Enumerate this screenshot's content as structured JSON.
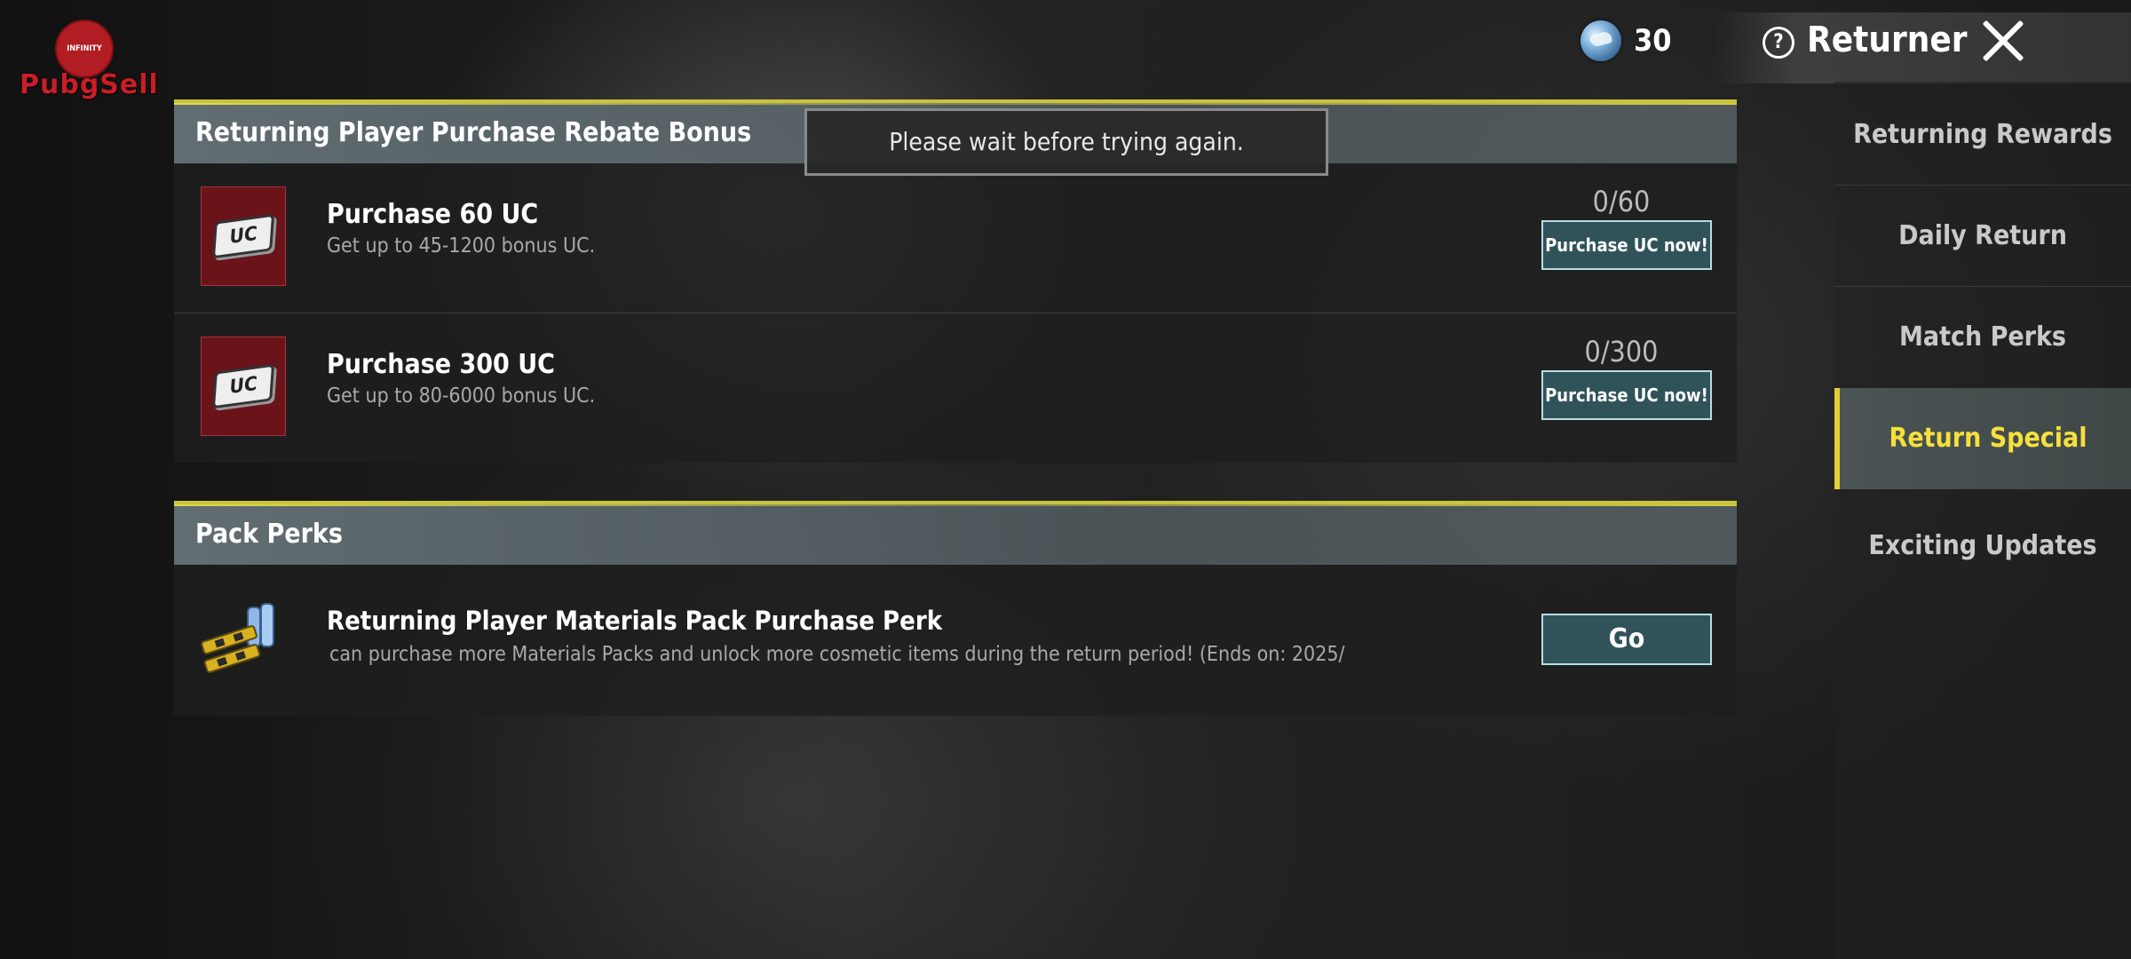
{
  "logo": {
    "badge_text": "INFINITY",
    "wordmark": "PubgSell"
  },
  "topbar": {
    "currency_value": "30",
    "title": "Returner",
    "help_glyph": "?"
  },
  "toast": {
    "message": "Please wait before trying again."
  },
  "rebate_section": {
    "header": "Returning Player Purchase Rebate Bonus",
    "items": [
      {
        "icon": "UC",
        "title": "Purchase 60 UC",
        "description": "Get up to 45-1200 bonus UC.",
        "progress": "0/60",
        "button": "Purchase UC now!"
      },
      {
        "icon": "UC",
        "title": "Purchase 300 UC",
        "description": "Get up to 80-6000 bonus UC.",
        "progress": "0/300",
        "button": "Purchase UC now!"
      }
    ]
  },
  "pack_section": {
    "header": "Pack Perks",
    "items": [
      {
        "title": "Returning Player Materials Pack Purchase Perk",
        "description": "can purchase more Materials Packs and unlock more cosmetic items during the return period! (Ends on: 2025/",
        "button": "Go"
      }
    ]
  },
  "sidebar": {
    "items": [
      {
        "label": "Returning Rewards",
        "active": false
      },
      {
        "label": "Daily Return",
        "active": false
      },
      {
        "label": "Match Perks",
        "active": false
      },
      {
        "label": "Return Special",
        "active": true
      },
      {
        "label": "Exciting Updates",
        "active": false
      }
    ]
  },
  "colors": {
    "accent_active": "#f6e03c",
    "header_line": "#c8c440",
    "button_fill": "#2f5359",
    "button_border": "#b9dde2"
  }
}
